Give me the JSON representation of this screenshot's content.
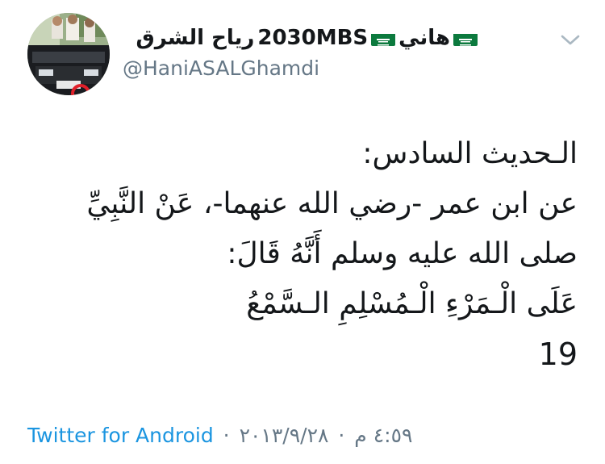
{
  "profile": {
    "name_segment_1": "رياح الشرق",
    "name_segment_2": "2030MBS",
    "name_segment_3": "هاني",
    "handle": "@HaniASALGhamdi",
    "flag_color": "#0c7a3e"
  },
  "menu": {
    "icon": "chevron-down-icon"
  },
  "tweet": {
    "lines": [
      "الـحديث السادس:",
      "عن ابن عمر -رضي الله عنهما-، عَنْ النَّبِيِّ",
      "صلى الله عليه وسلم أَنَّهُ قَالَ:",
      "عَلَى الْـمَرْءِ الْـمُسْلِمِ الـسَّمْعُ",
      "19"
    ]
  },
  "footer": {
    "source": "Twitter for Android",
    "date": "٢٠١٣/٩/٢٨",
    "time": "٤:٥٩ م",
    "separator": "·"
  },
  "colors": {
    "text": "#14171a",
    "secondary": "#657786",
    "link": "#1b95e0"
  }
}
